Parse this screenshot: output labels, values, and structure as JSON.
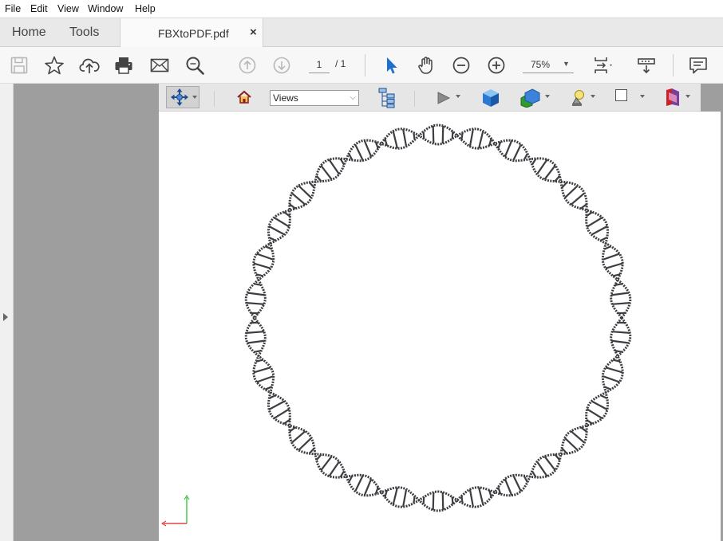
{
  "menu": [
    "File",
    "Edit",
    "View",
    "Window",
    "Help"
  ],
  "tabs": {
    "home": "Home",
    "tools": "Tools",
    "document": "FBXtoPDF.pdf",
    "close_symbol": "×"
  },
  "toolbar": {
    "page_current": "1",
    "page_total": "/ 1",
    "zoom": "75%"
  },
  "view3d": {
    "views_label": "Views"
  },
  "model": {
    "name": "dna-ring",
    "turns": 15,
    "stroke_color": "#3d3d42"
  }
}
